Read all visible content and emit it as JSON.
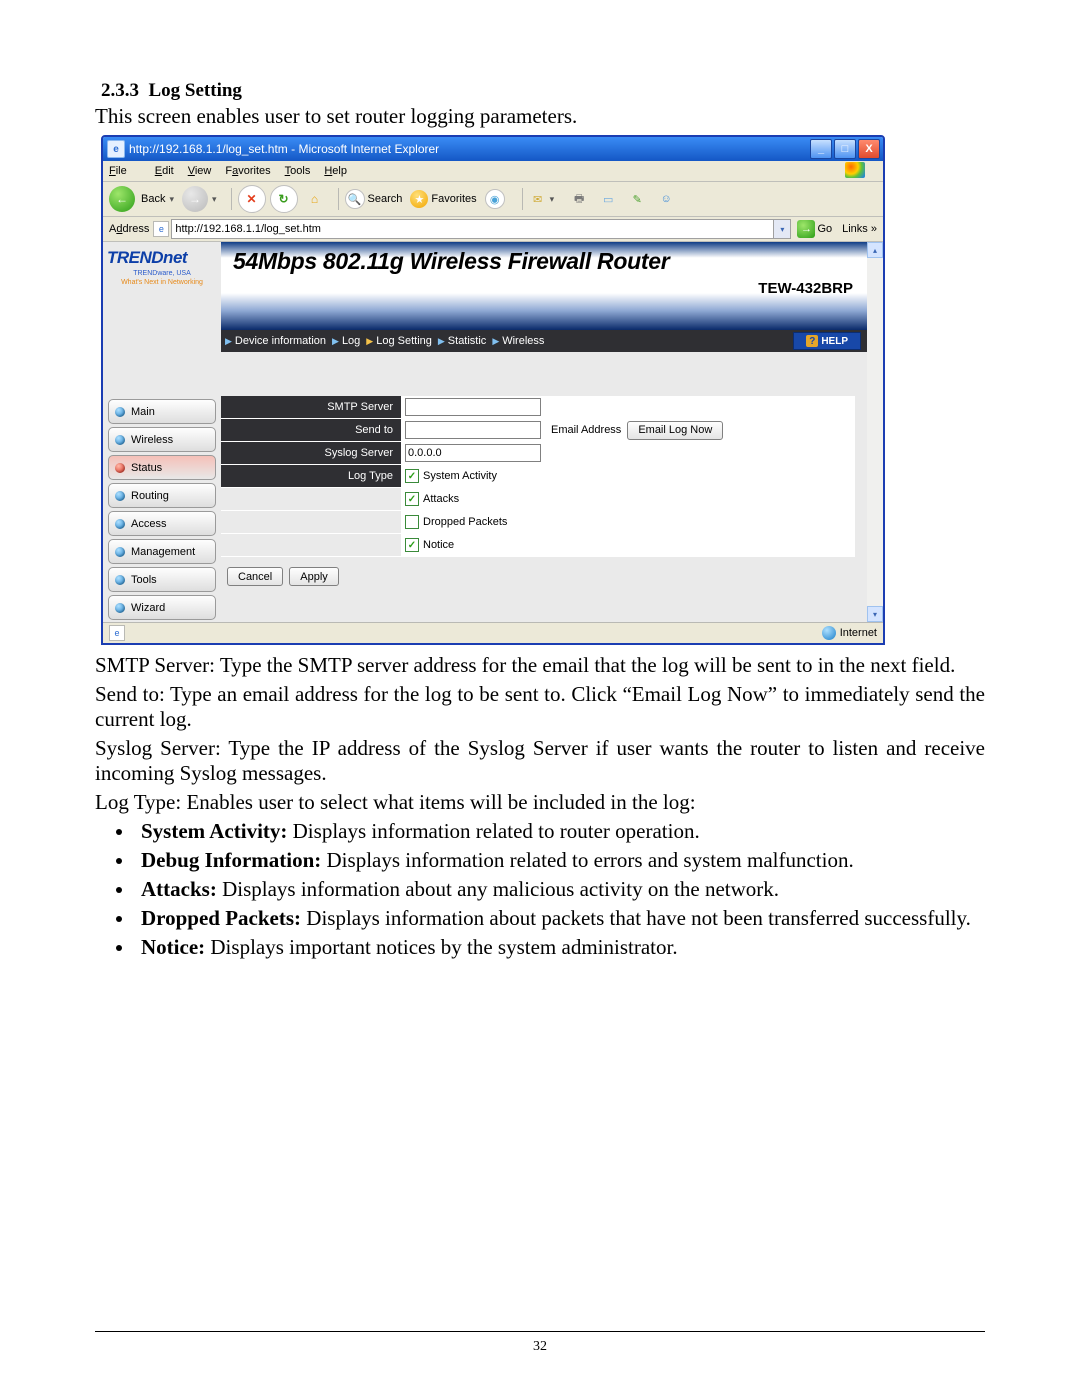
{
  "doc": {
    "section_no": "2.3.3",
    "section_title": "Log Setting",
    "intro": "This screen enables user to set router logging parameters.",
    "para_smtp": "SMTP Server: Type the SMTP server address for the email that the log will be sent to in the next field.",
    "para_sendto": "Send to: Type an email address for the log to be sent to. Click “Email Log Now” to immediately send the current log.",
    "para_syslog": "Syslog Server: Type the IP address of the Syslog Server if user wants the router to listen and receive incoming Syslog messages.",
    "para_logtype_intro": "Log Type: Enables user to select what items will be included in the log:",
    "bullets": {
      "b1_bold": "System Activity: ",
      "b1_txt": "Displays information related to router operation.",
      "b2_bold": "Debug Information: ",
      "b2_txt": "Displays information related to errors and system malfunction.",
      "b3_bold": "Attacks: ",
      "b3_txt": "Displays information about any malicious activity on the network.",
      "b4_bold": "Dropped Packets: ",
      "b4_txt": "Displays information about packets that have not been transferred successfully.",
      "b5_bold": "Notice: ",
      "b5_txt": "Displays important notices by the system administrator."
    },
    "page_number": "32"
  },
  "ie": {
    "title": "http://192.168.1.1/log_set.htm - Microsoft Internet Explorer",
    "menu": {
      "file": "File",
      "edit": "Edit",
      "view": "View",
      "fav": "Favorites",
      "tools": "Tools",
      "help": "Help"
    },
    "toolbar": {
      "back": "Back",
      "search": "Search",
      "favorites": "Favorites"
    },
    "address_label": "Address",
    "address_value": "http://192.168.1.1/log_set.htm",
    "go": "Go",
    "links": "Links",
    "status_zone": "Internet"
  },
  "router": {
    "logo": "TRENDnet",
    "logo_sub1": "TRENDware, USA",
    "logo_sub2": "What's Next in Networking",
    "banner_title": "54Mbps 802.11g Wireless Firewall Router",
    "banner_model": "TEW-432BRP",
    "side": {
      "main": "Main",
      "wireless": "Wireless",
      "status": "Status",
      "routing": "Routing",
      "access": "Access",
      "management": "Management",
      "tools": "Tools",
      "wizard": "Wizard"
    },
    "subnav": {
      "devinfo": "Device information",
      "log": "Log",
      "logset": "Log Setting",
      "stat": "Statistic",
      "wireless": "Wireless",
      "help": "HELP"
    },
    "form": {
      "smtp_label": "SMTP Server",
      "sendto_label": "Send to",
      "email_addr_label": "Email Address",
      "email_btn": "Email Log Now",
      "syslog_label": "Syslog Server",
      "syslog_value": "0.0.0.0",
      "logtype_label": "Log Type",
      "chk_sys": "System Activity",
      "chk_attacks": "Attacks",
      "chk_dropped": "Dropped Packets",
      "chk_notice": "Notice",
      "cancel": "Cancel",
      "apply": "Apply"
    }
  }
}
